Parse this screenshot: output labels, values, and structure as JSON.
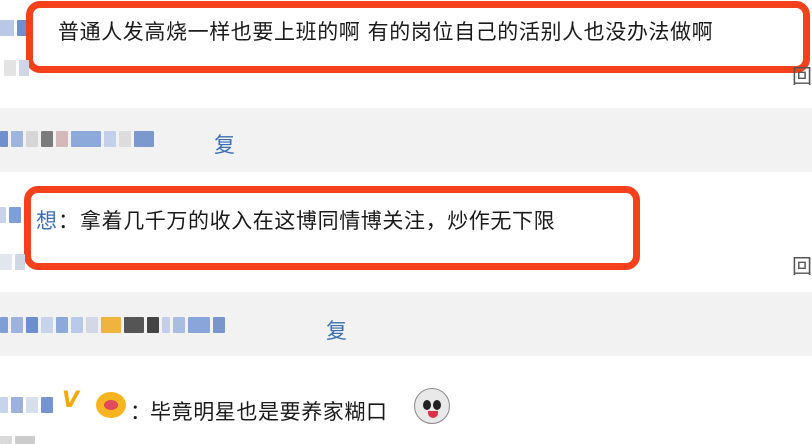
{
  "comments": [
    {
      "text": "普通人发高烧一样也要上班的啊 有的岗位自己的活别人也没办法做啊",
      "highlighted": true
    },
    {
      "reply_suffix": "复"
    },
    {
      "author_suffix": "想",
      "separator": "：",
      "text": "拿着几千万的收入在这博同情博关注，炒作无下限",
      "highlighted": true
    },
    {
      "reply_suffix": "复"
    },
    {
      "badge": "V",
      "separator": "：",
      "text": "毕竟明星也是要养家糊口",
      "emoji": "surprised-face-icon"
    }
  ],
  "edge_icons": [
    "回",
    "回"
  ],
  "colors": {
    "highlight": "#f5401c",
    "link": "#3b6fb5",
    "alt_row": "#f2f2f2",
    "vip": "#f6b51e"
  }
}
